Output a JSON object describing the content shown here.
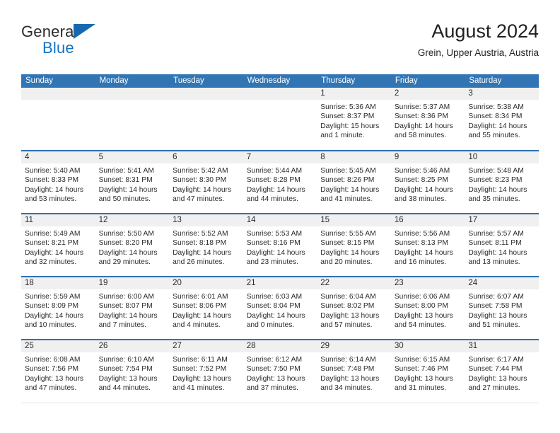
{
  "brand": {
    "name_part1": "General",
    "name_part2": "Blue",
    "flag_icon": "triangle-flag-icon",
    "accent_color": "#1668b0"
  },
  "header": {
    "title": "August 2024",
    "location": "Grein, Upper Austria, Austria"
  },
  "theme": {
    "header_blue": "#3175b4",
    "row_separator_blue": "#2f72b2",
    "daynum_band_gray": "#f0f0f0"
  },
  "weekdays": [
    "Sunday",
    "Monday",
    "Tuesday",
    "Wednesday",
    "Thursday",
    "Friday",
    "Saturday"
  ],
  "weeks": [
    [
      {
        "day": "",
        "sunrise": "",
        "sunset": "",
        "daylight": "",
        "empty": true
      },
      {
        "day": "",
        "sunrise": "",
        "sunset": "",
        "daylight": "",
        "empty": true
      },
      {
        "day": "",
        "sunrise": "",
        "sunset": "",
        "daylight": "",
        "empty": true
      },
      {
        "day": "",
        "sunrise": "",
        "sunset": "",
        "daylight": "",
        "empty": true
      },
      {
        "day": "1",
        "sunrise": "Sunrise: 5:36 AM",
        "sunset": "Sunset: 8:37 PM",
        "daylight": "Daylight: 15 hours and 1 minute."
      },
      {
        "day": "2",
        "sunrise": "Sunrise: 5:37 AM",
        "sunset": "Sunset: 8:36 PM",
        "daylight": "Daylight: 14 hours and 58 minutes."
      },
      {
        "day": "3",
        "sunrise": "Sunrise: 5:38 AM",
        "sunset": "Sunset: 8:34 PM",
        "daylight": "Daylight: 14 hours and 55 minutes."
      }
    ],
    [
      {
        "day": "4",
        "sunrise": "Sunrise: 5:40 AM",
        "sunset": "Sunset: 8:33 PM",
        "daylight": "Daylight: 14 hours and 53 minutes."
      },
      {
        "day": "5",
        "sunrise": "Sunrise: 5:41 AM",
        "sunset": "Sunset: 8:31 PM",
        "daylight": "Daylight: 14 hours and 50 minutes."
      },
      {
        "day": "6",
        "sunrise": "Sunrise: 5:42 AM",
        "sunset": "Sunset: 8:30 PM",
        "daylight": "Daylight: 14 hours and 47 minutes."
      },
      {
        "day": "7",
        "sunrise": "Sunrise: 5:44 AM",
        "sunset": "Sunset: 8:28 PM",
        "daylight": "Daylight: 14 hours and 44 minutes."
      },
      {
        "day": "8",
        "sunrise": "Sunrise: 5:45 AM",
        "sunset": "Sunset: 8:26 PM",
        "daylight": "Daylight: 14 hours and 41 minutes."
      },
      {
        "day": "9",
        "sunrise": "Sunrise: 5:46 AM",
        "sunset": "Sunset: 8:25 PM",
        "daylight": "Daylight: 14 hours and 38 minutes."
      },
      {
        "day": "10",
        "sunrise": "Sunrise: 5:48 AM",
        "sunset": "Sunset: 8:23 PM",
        "daylight": "Daylight: 14 hours and 35 minutes."
      }
    ],
    [
      {
        "day": "11",
        "sunrise": "Sunrise: 5:49 AM",
        "sunset": "Sunset: 8:21 PM",
        "daylight": "Daylight: 14 hours and 32 minutes."
      },
      {
        "day": "12",
        "sunrise": "Sunrise: 5:50 AM",
        "sunset": "Sunset: 8:20 PM",
        "daylight": "Daylight: 14 hours and 29 minutes."
      },
      {
        "day": "13",
        "sunrise": "Sunrise: 5:52 AM",
        "sunset": "Sunset: 8:18 PM",
        "daylight": "Daylight: 14 hours and 26 minutes."
      },
      {
        "day": "14",
        "sunrise": "Sunrise: 5:53 AM",
        "sunset": "Sunset: 8:16 PM",
        "daylight": "Daylight: 14 hours and 23 minutes."
      },
      {
        "day": "15",
        "sunrise": "Sunrise: 5:55 AM",
        "sunset": "Sunset: 8:15 PM",
        "daylight": "Daylight: 14 hours and 20 minutes."
      },
      {
        "day": "16",
        "sunrise": "Sunrise: 5:56 AM",
        "sunset": "Sunset: 8:13 PM",
        "daylight": "Daylight: 14 hours and 16 minutes."
      },
      {
        "day": "17",
        "sunrise": "Sunrise: 5:57 AM",
        "sunset": "Sunset: 8:11 PM",
        "daylight": "Daylight: 14 hours and 13 minutes."
      }
    ],
    [
      {
        "day": "18",
        "sunrise": "Sunrise: 5:59 AM",
        "sunset": "Sunset: 8:09 PM",
        "daylight": "Daylight: 14 hours and 10 minutes."
      },
      {
        "day": "19",
        "sunrise": "Sunrise: 6:00 AM",
        "sunset": "Sunset: 8:07 PM",
        "daylight": "Daylight: 14 hours and 7 minutes."
      },
      {
        "day": "20",
        "sunrise": "Sunrise: 6:01 AM",
        "sunset": "Sunset: 8:06 PM",
        "daylight": "Daylight: 14 hours and 4 minutes."
      },
      {
        "day": "21",
        "sunrise": "Sunrise: 6:03 AM",
        "sunset": "Sunset: 8:04 PM",
        "daylight": "Daylight: 14 hours and 0 minutes."
      },
      {
        "day": "22",
        "sunrise": "Sunrise: 6:04 AM",
        "sunset": "Sunset: 8:02 PM",
        "daylight": "Daylight: 13 hours and 57 minutes."
      },
      {
        "day": "23",
        "sunrise": "Sunrise: 6:06 AM",
        "sunset": "Sunset: 8:00 PM",
        "daylight": "Daylight: 13 hours and 54 minutes."
      },
      {
        "day": "24",
        "sunrise": "Sunrise: 6:07 AM",
        "sunset": "Sunset: 7:58 PM",
        "daylight": "Daylight: 13 hours and 51 minutes."
      }
    ],
    [
      {
        "day": "25",
        "sunrise": "Sunrise: 6:08 AM",
        "sunset": "Sunset: 7:56 PM",
        "daylight": "Daylight: 13 hours and 47 minutes."
      },
      {
        "day": "26",
        "sunrise": "Sunrise: 6:10 AM",
        "sunset": "Sunset: 7:54 PM",
        "daylight": "Daylight: 13 hours and 44 minutes."
      },
      {
        "day": "27",
        "sunrise": "Sunrise: 6:11 AM",
        "sunset": "Sunset: 7:52 PM",
        "daylight": "Daylight: 13 hours and 41 minutes."
      },
      {
        "day": "28",
        "sunrise": "Sunrise: 6:12 AM",
        "sunset": "Sunset: 7:50 PM",
        "daylight": "Daylight: 13 hours and 37 minutes."
      },
      {
        "day": "29",
        "sunrise": "Sunrise: 6:14 AM",
        "sunset": "Sunset: 7:48 PM",
        "daylight": "Daylight: 13 hours and 34 minutes."
      },
      {
        "day": "30",
        "sunrise": "Sunrise: 6:15 AM",
        "sunset": "Sunset: 7:46 PM",
        "daylight": "Daylight: 13 hours and 31 minutes."
      },
      {
        "day": "31",
        "sunrise": "Sunrise: 6:17 AM",
        "sunset": "Sunset: 7:44 PM",
        "daylight": "Daylight: 13 hours and 27 minutes."
      }
    ]
  ]
}
